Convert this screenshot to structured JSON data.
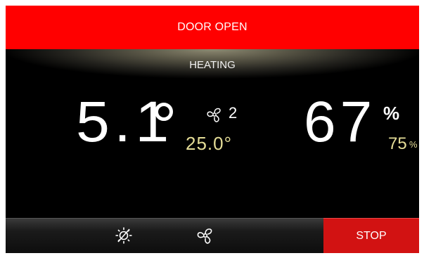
{
  "alert": {
    "text": "DOOR OPEN"
  },
  "mode": {
    "label": "HEATING"
  },
  "temperature": {
    "current": "5.1",
    "fan_speed": "2",
    "setpoint": "25.0°"
  },
  "humidity": {
    "current": "67",
    "unit": "%",
    "setpoint": "75",
    "setpoint_unit": "%"
  },
  "controls": {
    "stop_label": "STOP"
  },
  "colors": {
    "alert": "#ff0000",
    "stop": "#d21212",
    "setpoint": "#e5dd97",
    "background": "#000000"
  },
  "icons": [
    "fan-icon",
    "light-off-icon"
  ]
}
